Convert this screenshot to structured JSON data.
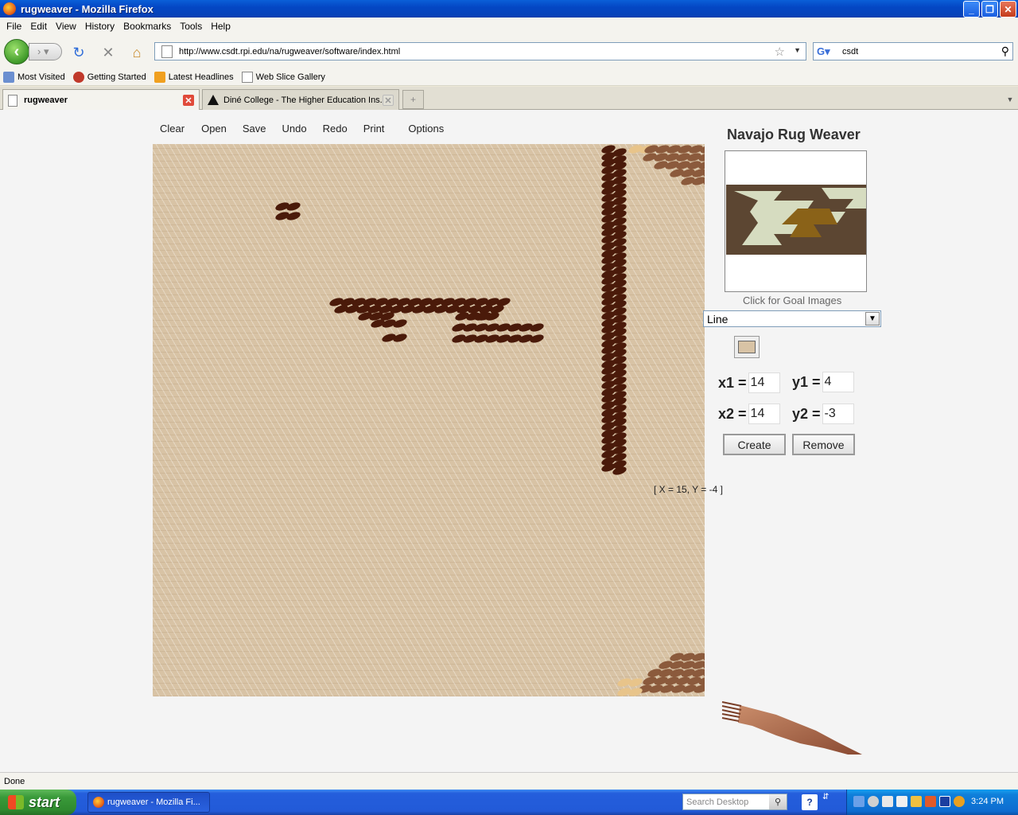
{
  "window": {
    "title": "rugweaver - Mozilla Firefox"
  },
  "menubar": [
    "File",
    "Edit",
    "View",
    "History",
    "Bookmarks",
    "Tools",
    "Help"
  ],
  "nav": {
    "url": "http://www.csdt.rpi.edu/na/rugweaver/software/index.html",
    "search_value": "csdt"
  },
  "bookmarks": [
    "Most Visited",
    "Getting Started",
    "Latest Headlines",
    "Web Slice Gallery"
  ],
  "tabs": [
    {
      "label": "rugweaver",
      "active": true
    },
    {
      "label": "Diné College - The Higher Education Ins...",
      "active": false
    }
  ],
  "app": {
    "menu": [
      "Clear",
      "Open",
      "Save",
      "Undo",
      "Redo",
      "Print",
      "Options"
    ],
    "title": "Navajo Rug Weaver",
    "goal_caption": "Click for Goal Images",
    "tool_selected": "Line",
    "x1_label": "x1 =",
    "x1": "14",
    "y1_label": "y1 =",
    "y1": "4",
    "x2_label": "x2 =",
    "x2": "14",
    "y2_label": "y2 =",
    "y2": "-3",
    "create_label": "Create",
    "remove_label": "Remove",
    "cursor_readout": "[ X = 15, Y = -4 ]",
    "colors": {
      "background": "#d8c3a5",
      "dark": "#4a1a0a",
      "medium": "#8b5a3c",
      "light": "#e8c48a"
    }
  },
  "status": "Done",
  "taskbar": {
    "start_label": "start",
    "task_label": "rugweaver - Mozilla Fi...",
    "search_placeholder": "Search Desktop",
    "clock": "3:24 PM"
  }
}
